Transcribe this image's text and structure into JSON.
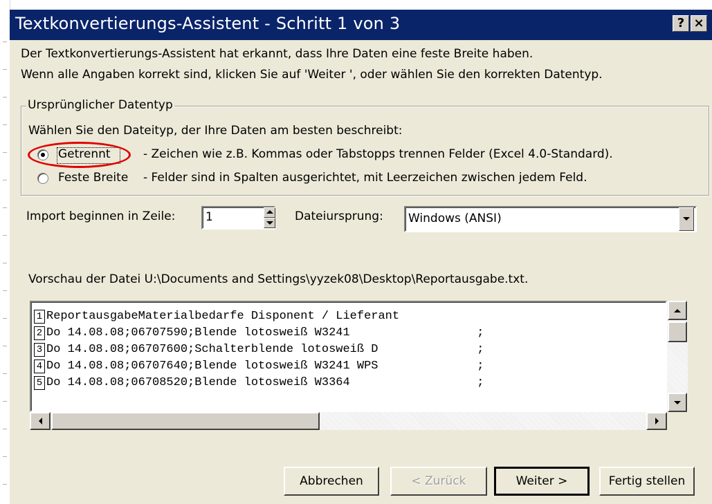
{
  "window": {
    "title": "Textkonvertierungs-Assistent - Schritt 1 von 3",
    "help_glyph": "?",
    "close_glyph": "×"
  },
  "intro": {
    "line1": "Der Textkonvertierungs-Assistent hat erkannt, dass Ihre Daten eine feste Breite haben.",
    "line2": "Wenn alle Angaben korrekt sind, klicken Sie auf 'Weiter ', oder wählen Sie den korrekten Datentyp."
  },
  "group": {
    "legend": "Ursprünglicher Datentyp",
    "instruction": "Wählen Sie den Dateityp, der Ihre Daten am besten beschreibt:",
    "options": [
      {
        "label": "Getrennt",
        "description": "- Zeichen wie z.B. Kommas oder Tabstopps trennen Felder (Excel 4.0-Standard).",
        "selected": true
      },
      {
        "label": "Feste Breite",
        "description": "- Felder sind in Spalten ausgerichtet, mit Leerzeichen zwischen jedem Feld.",
        "selected": false
      }
    ]
  },
  "import": {
    "start_row_label": "Import beginnen in Zeile:",
    "start_row_value": "1",
    "origin_label": "Dateiursprung:",
    "origin_value": "Windows (ANSI)"
  },
  "preview": {
    "label": "Vorschau der Datei U:\\Documents and Settings\\yyzek08\\Desktop\\Reportausgabe.txt.",
    "rows": [
      {
        "num": "1",
        "text": "ReportausgabeMaterialbedarfe Disponent / Lieferant"
      },
      {
        "num": "2",
        "text": "Do 14.08.08;06707590;Blende lotosweiß W3241                  ;"
      },
      {
        "num": "3",
        "text": "Do 14.08.08;06707600;Schalterblende lotosweiß D              ;"
      },
      {
        "num": "4",
        "text": "Do 14.08.08;06707640;Blende lotosweiß W3241 WPS              ;"
      },
      {
        "num": "5",
        "text": "Do 14.08.08;06708520;Blende lotosweiß W3364                  ;"
      }
    ]
  },
  "buttons": {
    "cancel": "Abbrechen",
    "back": "< Zurück",
    "next": "Weiter >",
    "finish": "Fertig stellen"
  }
}
